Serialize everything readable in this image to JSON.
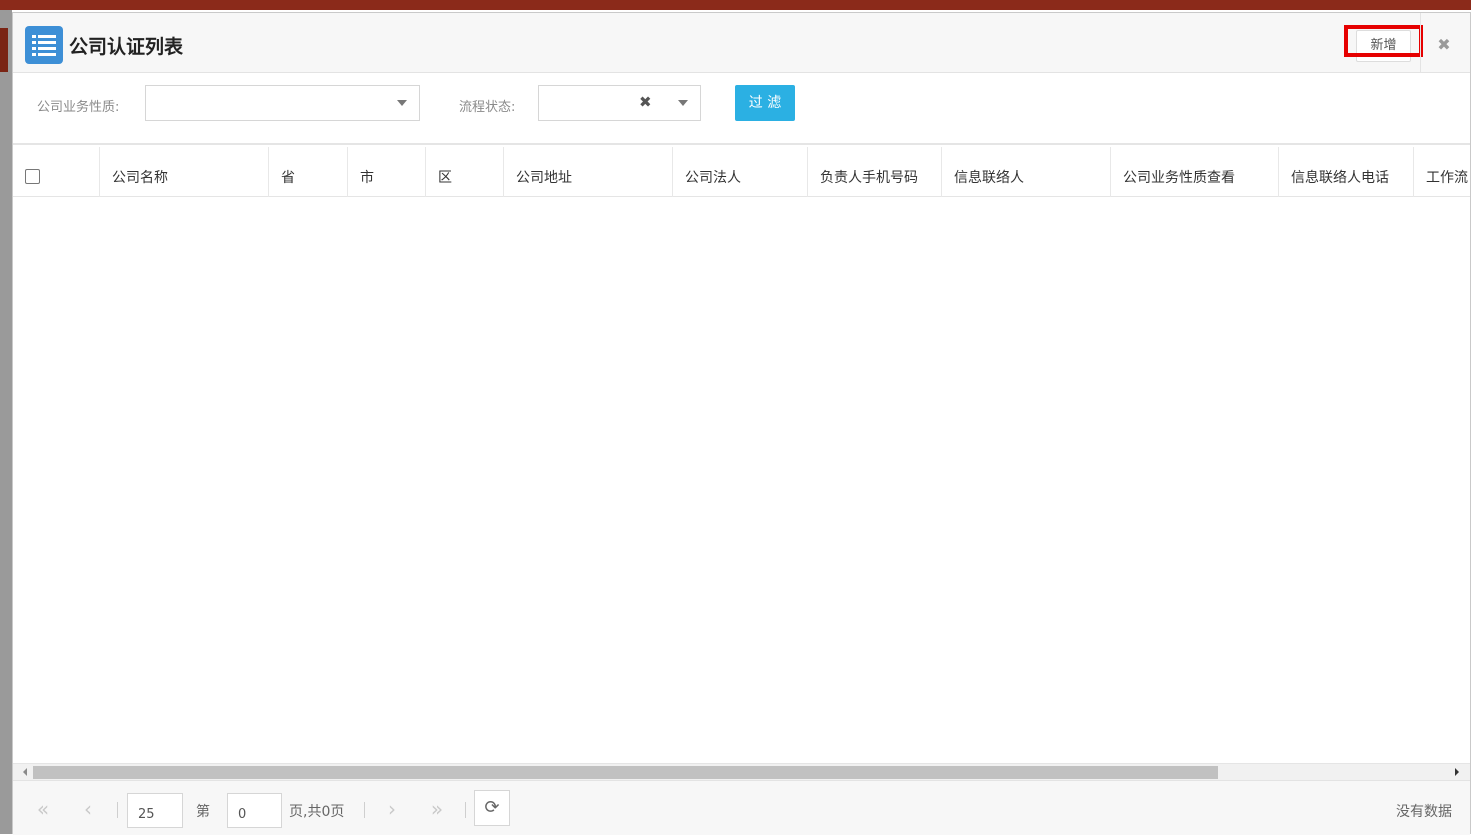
{
  "dialog": {
    "title": "公司认证列表",
    "add_label": "新增",
    "close_icon": "✖"
  },
  "filters": {
    "business_nature_label": "公司业务性质:",
    "business_nature_value": "",
    "process_status_label": "流程状态:",
    "process_status_value": "",
    "clear_icon": "✖",
    "filter_label": "过 滤"
  },
  "table": {
    "columns": [
      "公司名称",
      "省",
      "市",
      "区",
      "公司地址",
      "公司法人",
      "负责人手机号码",
      "信息联络人",
      "公司业务性质查看",
      "信息联络人电话",
      "工作流"
    ],
    "rows": []
  },
  "pager": {
    "first_icon": "«",
    "prev_icon": "‹",
    "page_size": "25",
    "page_prefix": "第",
    "page_number": "0",
    "page_suffix": "页,共0页",
    "next_icon": "›",
    "last_icon": "»",
    "refresh_icon": "⟳",
    "status": "没有数据"
  }
}
